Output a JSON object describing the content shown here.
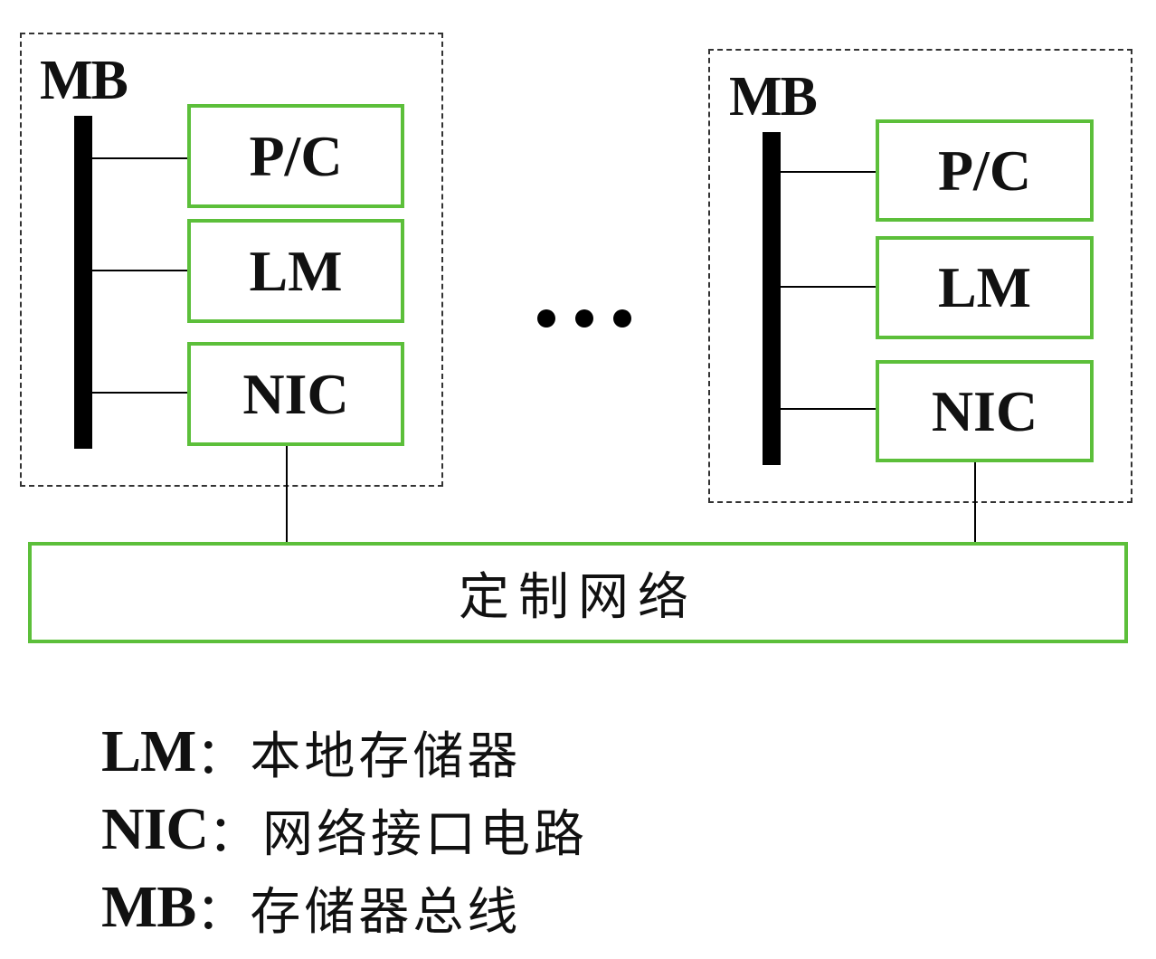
{
  "nodes": [
    {
      "bus_label": "MB",
      "components": [
        "P/C",
        "LM",
        "NIC"
      ]
    },
    {
      "bus_label": "MB",
      "components": [
        "P/C",
        "LM",
        "NIC"
      ]
    }
  ],
  "network_label": "定制网络",
  "legend": [
    {
      "key": "LM",
      "sep": "：",
      "desc": "本地存储器"
    },
    {
      "key": "NIC",
      "sep": "：",
      "desc": "网络接口电路"
    },
    {
      "key": "MB",
      "sep": "：",
      "desc": "存储器总线"
    }
  ],
  "colors": {
    "component_border": "#5cbf3a",
    "node_border": "#333333",
    "bus": "#000000"
  }
}
